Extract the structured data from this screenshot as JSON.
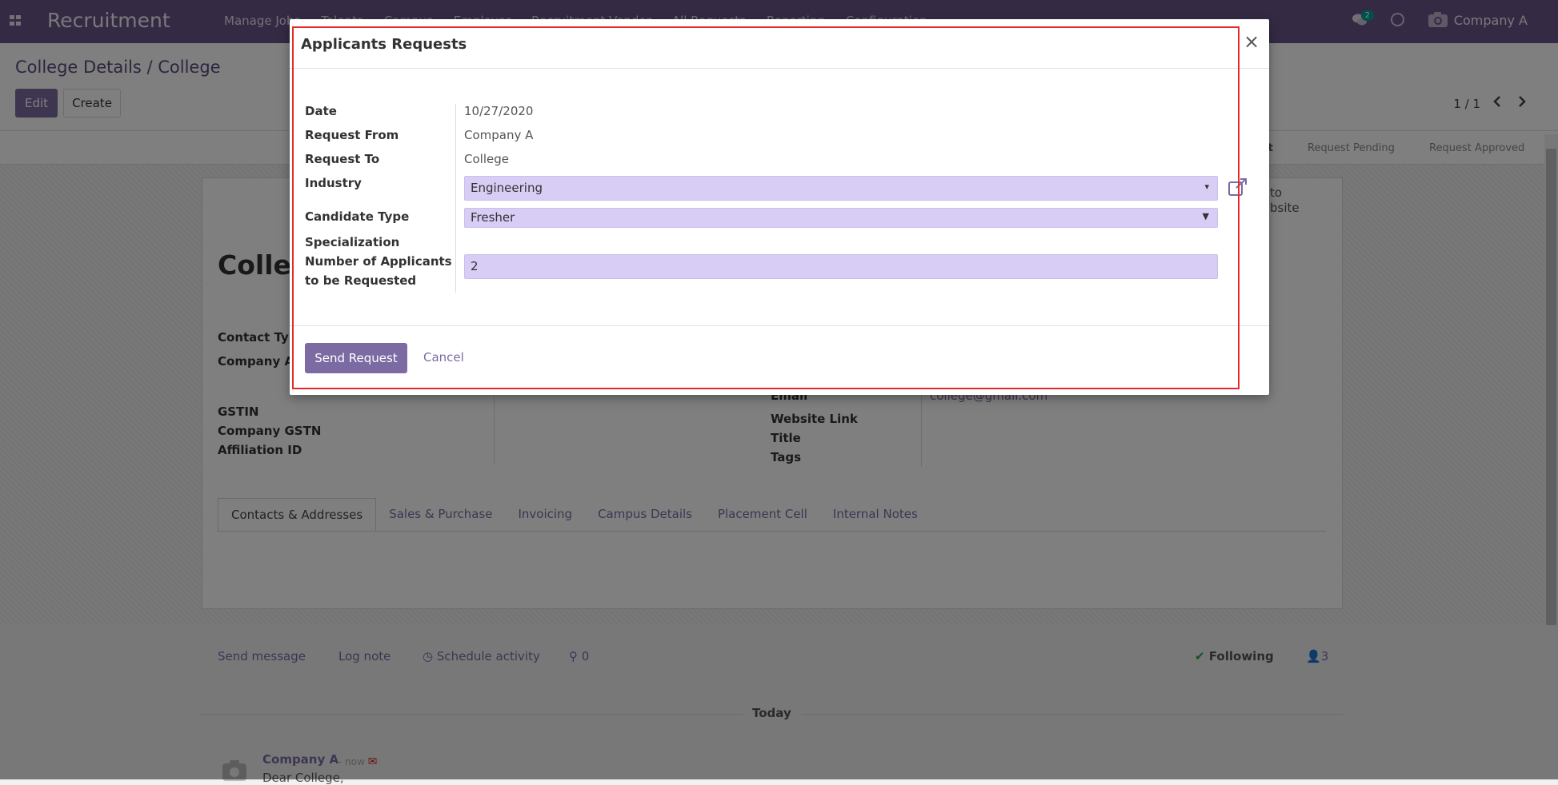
{
  "navbar": {
    "brand": "Recruitment",
    "menu": [
      "Manage Jobs",
      "Talents",
      "Campus",
      "Employer",
      "Recruitment Vendor",
      "All Requests",
      "Reporting",
      "Configuration"
    ],
    "chat_badge": "2",
    "company": "Company A"
  },
  "control": {
    "breadcrumb": "College Details / College",
    "edit_label": "Edit",
    "create_label": "Create",
    "pager": "1 / 1"
  },
  "statusbar": {
    "stages": [
      "ct",
      "Request Pending",
      "Request Approved"
    ]
  },
  "form": {
    "title": "Colleg",
    "labels_left": [
      "Contact Typ",
      "Company A",
      "GSTIN",
      "Company GSTN",
      "Affiliation ID"
    ],
    "labels_right": [
      "Email",
      "Website Link",
      "Title",
      "Tags"
    ],
    "email_value": "college@gmail.com",
    "smart_button": [
      "to",
      "bsite"
    ],
    "tabs": [
      "Contacts & Addresses",
      "Sales & Purchase",
      "Invoicing",
      "Campus Details",
      "Placement Cell",
      "Internal Notes"
    ]
  },
  "chatter": {
    "send_message": "Send message",
    "log_note": "Log note",
    "schedule_activity": "Schedule activity",
    "attachments": "0",
    "following": "Following",
    "followers": "3",
    "today": "Today",
    "message_author": "Company A",
    "message_time": "- now",
    "message_body": "Dear College,"
  },
  "modal": {
    "title": "Applicants Requests",
    "close_glyph": "×",
    "fields": {
      "date_label": "Date",
      "date_value": "10/27/2020",
      "request_from_label": "Request From",
      "request_from_value": "Company A",
      "request_to_label": "Request To",
      "request_to_value": "College",
      "industry_label": "Industry",
      "industry_value": "Engineering",
      "candidate_type_label": "Candidate Type",
      "candidate_type_value": "Fresher",
      "specialization_label": "Specialization",
      "num_applicants_label_1": "Number of Applicants",
      "num_applicants_label_2": "to be Requested",
      "num_applicants_value": "2"
    },
    "send_label": "Send Request",
    "cancel_label": "Cancel"
  },
  "colors": {
    "navbar": "#6b5488",
    "primary": "#7c6ba3",
    "field_bg": "#d7cdf5",
    "highlight": "#e8282b"
  }
}
